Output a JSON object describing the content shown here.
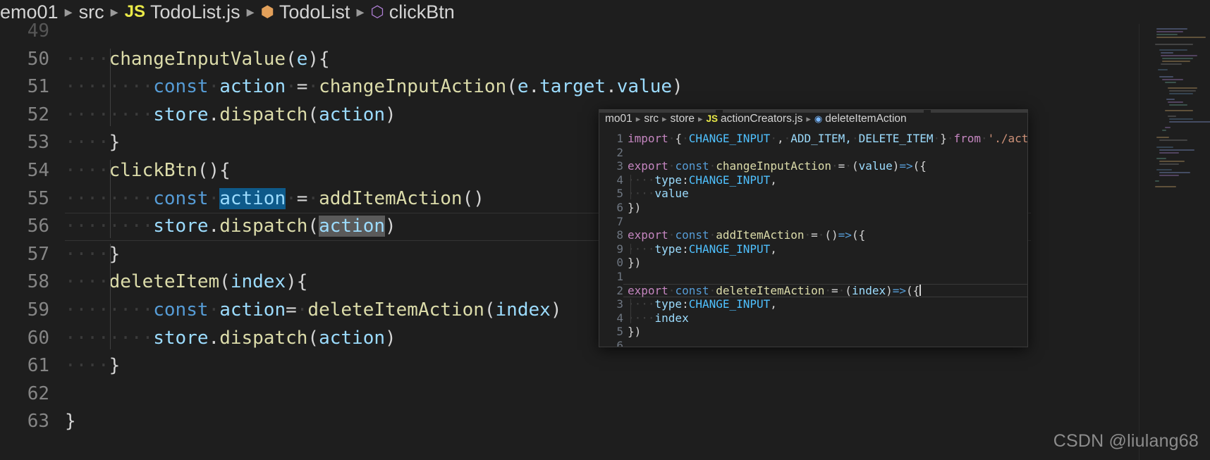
{
  "breadcrumb": {
    "segments": [
      {
        "label": "emo01",
        "icon": null
      },
      {
        "label": "src",
        "icon": null
      },
      {
        "label": "TodoList.js",
        "icon": "js-file-icon"
      },
      {
        "label": "TodoList",
        "icon": "class-icon"
      },
      {
        "label": "clickBtn",
        "icon": "method-icon"
      }
    ],
    "separator": "▸"
  },
  "editor": {
    "first_visible_line": 49,
    "lines": [
      {
        "num": "49",
        "partial": true,
        "tokens": []
      },
      {
        "num": "50",
        "tokens": [
          {
            "t": "····",
            "c": "lpad"
          },
          {
            "t": "changeInputValue",
            "c": "t-fn"
          },
          {
            "t": "(",
            "c": "t-punc"
          },
          {
            "t": "e",
            "c": "t-var"
          },
          {
            "t": "){",
            "c": "t-punc"
          }
        ]
      },
      {
        "num": "51",
        "tokens": [
          {
            "t": "····",
            "c": "lpad"
          },
          {
            "t": "····",
            "c": "lpad"
          },
          {
            "t": "const",
            "c": "t-kw"
          },
          {
            "t": "·",
            "c": "lpad"
          },
          {
            "t": "action",
            "c": "t-var"
          },
          {
            "t": "·",
            "c": "lpad"
          },
          {
            "t": "=",
            "c": "t-punc"
          },
          {
            "t": "·",
            "c": "lpad"
          },
          {
            "t": "changeInputAction",
            "c": "t-fn"
          },
          {
            "t": "(",
            "c": "t-punc"
          },
          {
            "t": "e",
            "c": "t-var"
          },
          {
            "t": ".",
            "c": "t-punc"
          },
          {
            "t": "target",
            "c": "t-var"
          },
          {
            "t": ".",
            "c": "t-punc"
          },
          {
            "t": "value",
            "c": "t-var"
          },
          {
            "t": ")",
            "c": "t-punc"
          }
        ]
      },
      {
        "num": "52",
        "tokens": [
          {
            "t": "····",
            "c": "lpad"
          },
          {
            "t": "····",
            "c": "lpad"
          },
          {
            "t": "store",
            "c": "t-var"
          },
          {
            "t": ".",
            "c": "t-punc"
          },
          {
            "t": "dispatch",
            "c": "t-fn"
          },
          {
            "t": "(",
            "c": "t-punc"
          },
          {
            "t": "action",
            "c": "t-var"
          },
          {
            "t": ")",
            "c": "t-punc"
          }
        ]
      },
      {
        "num": "53",
        "tokens": [
          {
            "t": "····",
            "c": "lpad"
          },
          {
            "t": "}",
            "c": "t-punc"
          }
        ]
      },
      {
        "num": "54",
        "tokens": [
          {
            "t": "····",
            "c": "lpad"
          },
          {
            "t": "clickBtn",
            "c": "t-fn"
          },
          {
            "t": "(){",
            "c": "t-punc"
          }
        ]
      },
      {
        "num": "55",
        "tokens": [
          {
            "t": "····",
            "c": "lpad"
          },
          {
            "t": "····",
            "c": "lpad"
          },
          {
            "t": "const",
            "c": "t-kw"
          },
          {
            "t": "·",
            "c": "lpad"
          },
          {
            "t": "action",
            "c": "t-var sel"
          },
          {
            "t": "·",
            "c": "lpad"
          },
          {
            "t": "=",
            "c": "t-punc"
          },
          {
            "t": "·",
            "c": "lpad"
          },
          {
            "t": "addItemAction",
            "c": "t-fn"
          },
          {
            "t": "()",
            "c": "t-punc"
          }
        ]
      },
      {
        "num": "56",
        "current": true,
        "tokens": [
          {
            "t": "····",
            "c": "lpad"
          },
          {
            "t": "····",
            "c": "lpad"
          },
          {
            "t": "store",
            "c": "t-var"
          },
          {
            "t": ".",
            "c": "t-punc"
          },
          {
            "t": "dispatch",
            "c": "t-fn"
          },
          {
            "t": "(",
            "c": "t-punc"
          },
          {
            "t": "action",
            "c": "t-var wordhl"
          },
          {
            "t": ")",
            "c": "t-punc"
          }
        ]
      },
      {
        "num": "57",
        "tokens": [
          {
            "t": "····",
            "c": "lpad"
          },
          {
            "t": "}",
            "c": "t-punc"
          }
        ]
      },
      {
        "num": "58",
        "tokens": [
          {
            "t": "····",
            "c": "lpad"
          },
          {
            "t": "deleteItem",
            "c": "t-fn"
          },
          {
            "t": "(",
            "c": "t-punc"
          },
          {
            "t": "index",
            "c": "t-var"
          },
          {
            "t": "){",
            "c": "t-punc"
          }
        ]
      },
      {
        "num": "59",
        "tokens": [
          {
            "t": "····",
            "c": "lpad"
          },
          {
            "t": "····",
            "c": "lpad"
          },
          {
            "t": "const",
            "c": "t-kw"
          },
          {
            "t": "·",
            "c": "lpad"
          },
          {
            "t": "action",
            "c": "t-var"
          },
          {
            "t": "=",
            "c": "t-punc"
          },
          {
            "t": "·",
            "c": "lpad"
          },
          {
            "t": "deleteItemAction",
            "c": "t-fn"
          },
          {
            "t": "(",
            "c": "t-punc"
          },
          {
            "t": "index",
            "c": "t-var"
          },
          {
            "t": ")",
            "c": "t-punc"
          }
        ]
      },
      {
        "num": "60",
        "tokens": [
          {
            "t": "····",
            "c": "lpad"
          },
          {
            "t": "····",
            "c": "lpad"
          },
          {
            "t": "store",
            "c": "t-var"
          },
          {
            "t": ".",
            "c": "t-punc"
          },
          {
            "t": "dispatch",
            "c": "t-fn"
          },
          {
            "t": "(",
            "c": "t-punc"
          },
          {
            "t": "action",
            "c": "t-var"
          },
          {
            "t": ")",
            "c": "t-punc"
          }
        ]
      },
      {
        "num": "61",
        "tokens": [
          {
            "t": "····",
            "c": "lpad"
          },
          {
            "t": "}",
            "c": "t-punc"
          }
        ]
      },
      {
        "num": "62",
        "tokens": []
      },
      {
        "num": "63",
        "tokens": [
          {
            "t": "}",
            "c": "t-punc"
          }
        ]
      }
    ]
  },
  "peek": {
    "breadcrumb": {
      "segments": [
        {
          "label": "mo01",
          "icon": null
        },
        {
          "label": "src",
          "icon": null
        },
        {
          "label": "store",
          "icon": null
        },
        {
          "label": "actionCreators.js",
          "icon": "js-file-icon"
        },
        {
          "label": "deleteItemAction",
          "icon": "method-icon"
        }
      ],
      "separator": "▸"
    },
    "first_visible_line": 1,
    "lines": [
      {
        "num": "1",
        "tokens": [
          {
            "t": "import",
            "c": "t-purple"
          },
          {
            "t": "·",
            "c": "p-lpad"
          },
          {
            "t": "{",
            "c": "t-punc"
          },
          {
            "t": "·",
            "c": "p-lpad"
          },
          {
            "t": "CHANGE_INPUT",
            "c": "t-const"
          },
          {
            "t": "·",
            "c": "p-lpad"
          },
          {
            "t": ",",
            "c": "t-punc"
          },
          {
            "t": "·",
            "c": "p-lpad"
          },
          {
            "t": "ADD_ITEM,",
            "c": "t-var"
          },
          {
            "t": "·",
            "c": "p-lpad"
          },
          {
            "t": "DELETE_ITEM",
            "c": "t-var"
          },
          {
            "t": "·",
            "c": "p-lpad"
          },
          {
            "t": "}",
            "c": "t-punc"
          },
          {
            "t": "·",
            "c": "p-lpad"
          },
          {
            "t": "from",
            "c": "t-purple"
          },
          {
            "t": "·",
            "c": "p-lpad"
          },
          {
            "t": "'./actionTypes'",
            "c": "t-str"
          }
        ]
      },
      {
        "num": "2",
        "tokens": []
      },
      {
        "num": "3",
        "tokens": [
          {
            "t": "export",
            "c": "t-purple"
          },
          {
            "t": "·",
            "c": "p-lpad"
          },
          {
            "t": "const",
            "c": "t-kw"
          },
          {
            "t": "·",
            "c": "p-lpad"
          },
          {
            "t": "changeInputAction",
            "c": "t-fn"
          },
          {
            "t": "·",
            "c": "p-lpad"
          },
          {
            "t": "=",
            "c": "t-punc"
          },
          {
            "t": "·",
            "c": "p-lpad"
          },
          {
            "t": "(",
            "c": "t-punc"
          },
          {
            "t": "value",
            "c": "t-var"
          },
          {
            "t": ")",
            "c": "t-punc"
          },
          {
            "t": "=>",
            "c": "t-arrow"
          },
          {
            "t": "({",
            "c": "t-punc"
          }
        ]
      },
      {
        "num": "4",
        "tokens": [
          {
            "t": "····",
            "c": "p-lpad"
          },
          {
            "t": "type",
            "c": "t-var"
          },
          {
            "t": ":",
            "c": "t-punc"
          },
          {
            "t": "CHANGE_INPUT",
            "c": "t-const"
          },
          {
            "t": ",",
            "c": "t-punc"
          }
        ]
      },
      {
        "num": "5",
        "tokens": [
          {
            "t": "····",
            "c": "p-lpad"
          },
          {
            "t": "value",
            "c": "t-var"
          }
        ]
      },
      {
        "num": "6",
        "tokens": [
          {
            "t": "})",
            "c": "t-punc"
          }
        ]
      },
      {
        "num": "7",
        "tokens": []
      },
      {
        "num": "8",
        "tokens": [
          {
            "t": "export",
            "c": "t-purple"
          },
          {
            "t": "·",
            "c": "p-lpad"
          },
          {
            "t": "const",
            "c": "t-kw"
          },
          {
            "t": "·",
            "c": "p-lpad"
          },
          {
            "t": "addItemAction",
            "c": "t-fn"
          },
          {
            "t": "·",
            "c": "p-lpad"
          },
          {
            "t": "=",
            "c": "t-punc"
          },
          {
            "t": "·",
            "c": "p-lpad"
          },
          {
            "t": "()",
            "c": "t-punc"
          },
          {
            "t": "=>",
            "c": "t-arrow"
          },
          {
            "t": "({",
            "c": "t-punc"
          }
        ]
      },
      {
        "num": "9",
        "tokens": [
          {
            "t": "····",
            "c": "p-lpad"
          },
          {
            "t": "type",
            "c": "t-var"
          },
          {
            "t": ":",
            "c": "t-punc"
          },
          {
            "t": "CHANGE_INPUT",
            "c": "t-const"
          },
          {
            "t": ",",
            "c": "t-punc"
          }
        ]
      },
      {
        "num": "0",
        "tokens": [
          {
            "t": "})",
            "c": "t-punc"
          }
        ]
      },
      {
        "num": "1",
        "tokens": []
      },
      {
        "num": "2",
        "current": true,
        "tokens": [
          {
            "t": "export",
            "c": "t-purple"
          },
          {
            "t": "·",
            "c": "p-lpad"
          },
          {
            "t": "const",
            "c": "t-kw"
          },
          {
            "t": "·",
            "c": "p-lpad"
          },
          {
            "t": "deleteItemAction",
            "c": "t-fn"
          },
          {
            "t": "·",
            "c": "p-lpad"
          },
          {
            "t": "=",
            "c": "t-punc"
          },
          {
            "t": "·",
            "c": "p-lpad"
          },
          {
            "t": "(",
            "c": "t-punc"
          },
          {
            "t": "index",
            "c": "t-var"
          },
          {
            "t": ")",
            "c": "t-punc"
          },
          {
            "t": "=>",
            "c": "t-arrow"
          },
          {
            "t": "({",
            "c": "t-punc"
          }
        ]
      },
      {
        "num": "3",
        "tokens": [
          {
            "t": "····",
            "c": "p-lpad"
          },
          {
            "t": "type",
            "c": "t-var"
          },
          {
            "t": ":",
            "c": "t-punc"
          },
          {
            "t": "CHANGE_INPUT",
            "c": "t-const"
          },
          {
            "t": ",",
            "c": "t-punc"
          }
        ]
      },
      {
        "num": "4",
        "tokens": [
          {
            "t": "····",
            "c": "p-lpad"
          },
          {
            "t": "index",
            "c": "t-var"
          }
        ]
      },
      {
        "num": "5",
        "tokens": [
          {
            "t": "})",
            "c": "t-punc"
          }
        ]
      },
      {
        "num": "6",
        "tokens": []
      }
    ]
  },
  "watermark": "CSDN @liulang68",
  "colors": {
    "editor_background": "#1e1e1e",
    "peek_background": "#1f1f1f",
    "line_number": "#858585",
    "selection": "#0e5a8a",
    "word_highlight": "#5a5a5a",
    "keyword": "#569cd6",
    "function": "#dcdcaa",
    "variable": "#9cdcfe",
    "keyword_control": "#c586c0",
    "string": "#ce9178",
    "constant": "#4fc1ff"
  }
}
